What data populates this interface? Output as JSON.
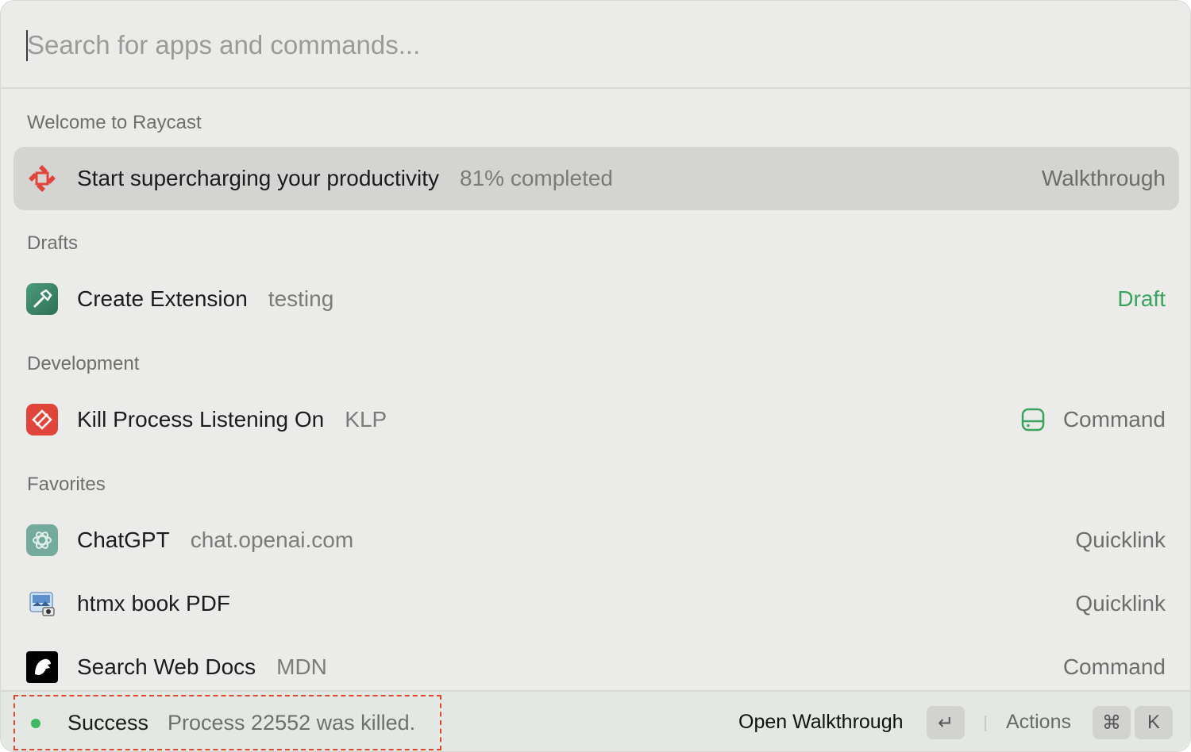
{
  "search": {
    "placeholder": "Search for apps and commands..."
  },
  "sections": [
    {
      "header": "Welcome to Raycast",
      "items": [
        {
          "title": "Start supercharging your productivity",
          "subtitle": "81% completed",
          "accessory": "Walkthrough",
          "icon": "raycast-logo-icon",
          "selected": true
        }
      ]
    },
    {
      "header": "Drafts",
      "items": [
        {
          "title": "Create Extension",
          "subtitle": "testing",
          "accessory": "Draft",
          "icon": "hammer-icon",
          "accessory_color": "#3aa35c"
        }
      ]
    },
    {
      "header": "Development",
      "items": [
        {
          "title": "Kill Process Listening On",
          "subtitle": "KLP",
          "accessory": "Command",
          "icon": "kill-process-icon",
          "accessory_icon": "drive-icon"
        }
      ]
    },
    {
      "header": "Favorites",
      "items": [
        {
          "title": "ChatGPT",
          "subtitle": "chat.openai.com",
          "accessory": "Quicklink",
          "icon": "chatgpt-icon"
        },
        {
          "title": "htmx book PDF",
          "subtitle": "",
          "accessory": "Quicklink",
          "icon": "preview-app-icon"
        },
        {
          "title": "Search Web Docs",
          "subtitle": "MDN",
          "accessory": "Command",
          "icon": "mdn-icon"
        }
      ]
    }
  ],
  "footer": {
    "toast_title": "Success",
    "toast_message": "Process 22552 was killed.",
    "primary_action": "Open Walkthrough",
    "primary_key": "↵",
    "actions_label": "Actions",
    "actions_keys": [
      "⌘",
      "K"
    ]
  },
  "colors": {
    "accent_green": "#3aa35c",
    "toast_dot": "#3fb862",
    "highlight_border": "#e0462f",
    "raycast_red": "#e0453c"
  }
}
